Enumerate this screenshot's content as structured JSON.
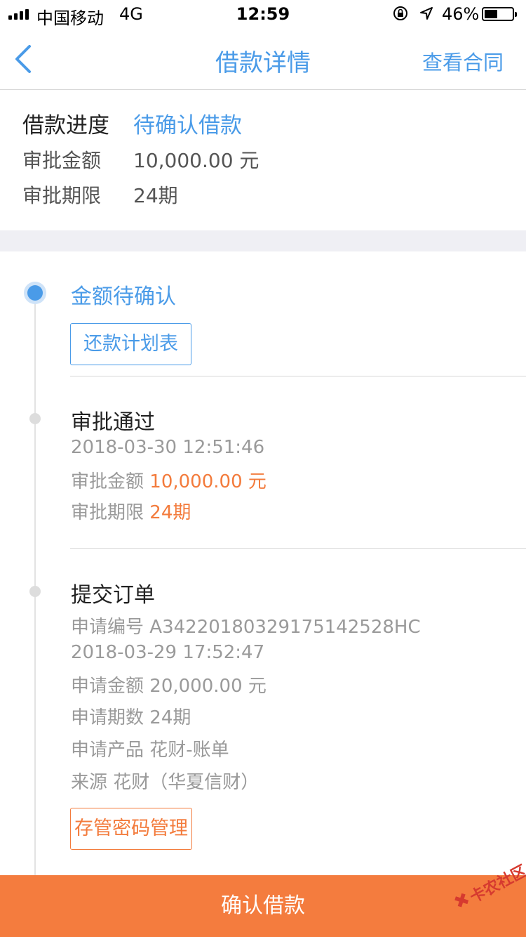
{
  "status_bar": {
    "carrier": "中国移动",
    "network": "4G",
    "time": "12:59",
    "battery_percent": "46%",
    "battery_level": 0.46
  },
  "nav": {
    "back_icon": "chevron-left-icon",
    "title": "借款详情",
    "action": "查看合同"
  },
  "summary": {
    "progress_label": "借款进度",
    "progress_value": "待确认借款",
    "amount_label": "审批金额",
    "amount_value": "10,000.00 元",
    "term_label": "审批期限",
    "term_value": "24期"
  },
  "timeline": {
    "step1": {
      "title": "金额待确认",
      "button": "还款计划表"
    },
    "step2": {
      "title": "审批通过",
      "datetime": "2018-03-30 12:51:46",
      "amount_label": "审批金额",
      "amount_value": "10,000.00 元",
      "term_label": "审批期限",
      "term_value": "24期"
    },
    "step3": {
      "title": "提交订单",
      "app_no_label": "申请编号",
      "app_no_value": "A342201803291751425​28HC",
      "datetime": "2018-03-29 17:52:47",
      "amount_label": "申请金额",
      "amount_value": "20,000.00 元",
      "periods_label": "申请期数",
      "periods_value": "24期",
      "product_label": "申请产品",
      "product_value": "花财-账单",
      "source_label": "来源",
      "source_value": "花财（华夏信财）",
      "button": "存管密码管理"
    }
  },
  "bottom": {
    "confirm_button": "确认借款"
  },
  "watermark": {
    "text": "卡农社区"
  },
  "colors": {
    "accent_blue": "#4a9be8",
    "accent_orange": "#f37b3c",
    "confirm_bg": "#f47c3e"
  }
}
